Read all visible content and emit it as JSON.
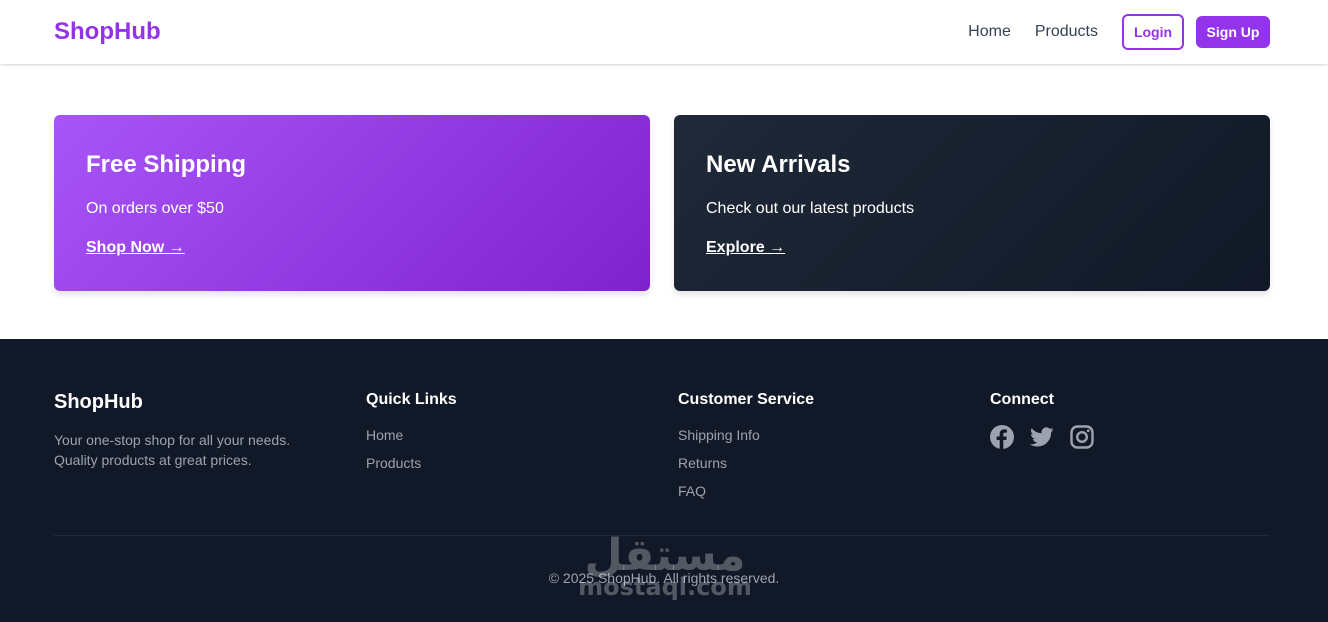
{
  "header": {
    "brand": "ShopHub",
    "nav": [
      "Home",
      "Products"
    ],
    "login_label": "Login",
    "signup_label": "Sign Up"
  },
  "promos": [
    {
      "title": "Free Shipping",
      "text": "On orders over $50",
      "link": "Shop Now →",
      "gradient": [
        "#a855f7",
        "#7e22ce"
      ]
    },
    {
      "title": "New Arrivals",
      "text": "Check out our latest products",
      "link": "Explore →",
      "gradient": [
        "#1f2937",
        "#111827"
      ]
    }
  ],
  "footer": {
    "brand": "ShopHub",
    "description": "Your one-stop shop for all your needs. Quality products at great prices.",
    "quick_links": {
      "heading": "Quick Links",
      "items": [
        "Home",
        "Products"
      ]
    },
    "customer_service": {
      "heading": "Customer Service",
      "items": [
        "Shipping Info",
        "Returns",
        "FAQ"
      ]
    },
    "connect": {
      "heading": "Connect",
      "icons": [
        "facebook-icon",
        "twitter-icon",
        "instagram-icon"
      ]
    },
    "copyright": "© 2025 ShopHub. All rights reserved."
  },
  "watermark": {
    "arabic": "مستقل",
    "latin": "mostaql.com"
  },
  "colors": {
    "accent": "#9333ea",
    "footer_bg": "#111827",
    "muted_text": "#9ca3af"
  }
}
